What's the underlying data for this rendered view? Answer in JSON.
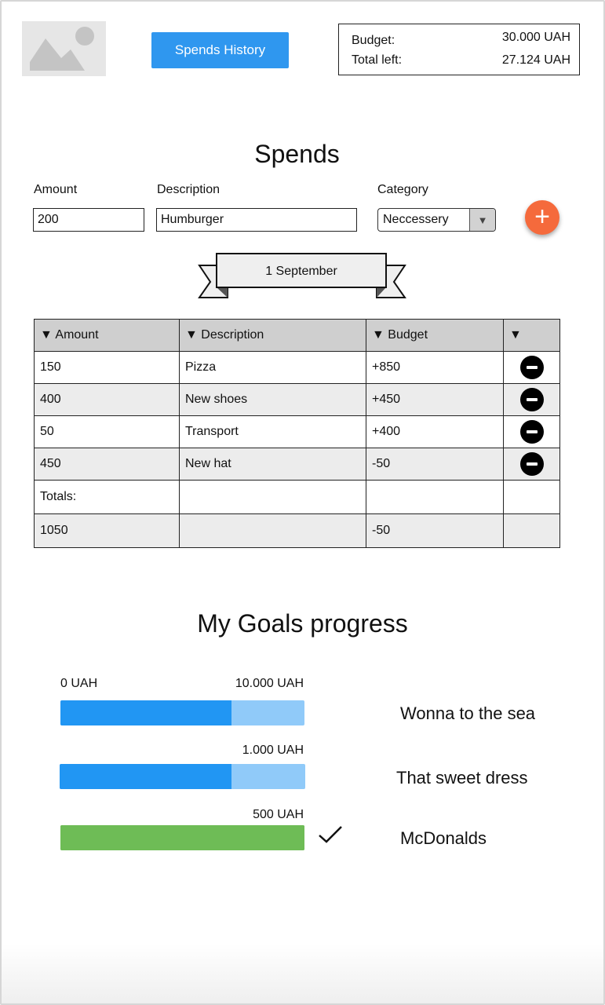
{
  "header": {
    "history_button": "Spends History",
    "budget_label": "Budget:",
    "budget_value": "30.000 UAH",
    "total_left_label": "Total left:",
    "total_left_value": "27.124 UAH"
  },
  "spends": {
    "title": "Spends",
    "form": {
      "amount_label": "Amount",
      "amount_value": "200",
      "description_label": "Description",
      "description_value": "Humburger",
      "category_label": "Category",
      "category_value": "Neccessery",
      "add_icon": "plus-icon"
    },
    "date_banner": "1 September",
    "table": {
      "headers": [
        "Amount",
        "Description",
        "Budget",
        ""
      ],
      "rows": [
        {
          "amount": "150",
          "description": "Pizza",
          "budget": "+850"
        },
        {
          "amount": "400",
          "description": "New shoes",
          "budget": "+450"
        },
        {
          "amount": "50",
          "description": "Transport",
          "budget": "+400"
        },
        {
          "amount": "450",
          "description": "New hat",
          "budget": "-50"
        }
      ],
      "totals_label": "Totals:",
      "total_amount": "1050",
      "total_budget": "-50"
    }
  },
  "goals": {
    "title": "My Goals progress",
    "scale_min": "0 UAH",
    "items": [
      {
        "max_label": "10.000 UAH",
        "name": "Wonna to the sea",
        "progress": 0.7,
        "color": "#2196f3",
        "track_color": "#90caf9",
        "done": false
      },
      {
        "max_label": "1.000 UAH",
        "name": "That sweet dress",
        "progress": 0.7,
        "color": "#2196f3",
        "track_color": "#90caf9",
        "done": false
      },
      {
        "max_label": "500 UAH",
        "name": "McDonalds",
        "progress": 1.0,
        "color": "#6ebc56",
        "track_color": "#6ebc56",
        "done": true
      }
    ]
  },
  "colors": {
    "accent_blue": "#2f97ef",
    "add_button": "#f56a3c",
    "goal_complete": "#6ebc56"
  }
}
